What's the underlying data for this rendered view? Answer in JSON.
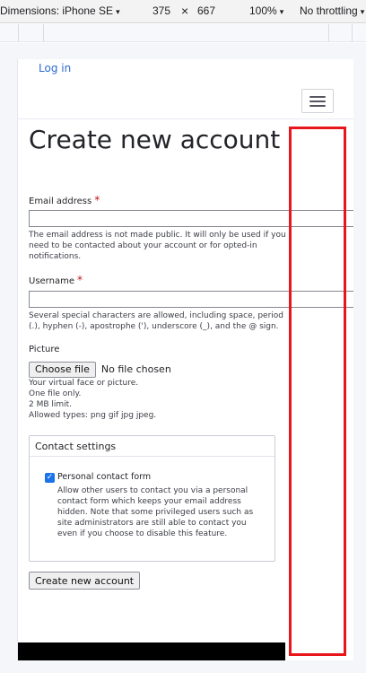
{
  "devtools": {
    "dimensions_label": "Dimensions: iPhone SE",
    "width": "375",
    "times": "×",
    "height": "667",
    "zoom": "100%",
    "throttle": "No throttling",
    "caret": "▾"
  },
  "header": {
    "login_link": "Log in",
    "menu_icon": "hamburger-menu-icon"
  },
  "page": {
    "title": "Create new account"
  },
  "form": {
    "email": {
      "label": "Email address",
      "required_marker": "*",
      "value": "",
      "help": "The email address is not made public. It will only be used if you need to be contacted about your account or for opted-in notifications."
    },
    "username": {
      "label": "Username",
      "required_marker": "*",
      "value": "",
      "help": "Several special characters are allowed, including space, period (.), hyphen (-), apostrophe ('), underscore (_), and the @ sign."
    },
    "picture": {
      "label": "Picture",
      "button_label": "Choose file",
      "status": "No file chosen",
      "help_lines": [
        "Your virtual face or picture.",
        "One file only.",
        "2 MB limit.",
        "Allowed types: png gif jpg jpeg."
      ]
    },
    "contact_settings": {
      "legend": "Contact settings",
      "checkbox_checked": true,
      "checkbox_mark": "✓",
      "checkbox_label": "Personal contact form",
      "description": "Allow other users to contact you via a personal contact form which keeps your email address hidden. Note that some privileged users such as site administrators are still able to contact you even if you choose to disable this feature."
    },
    "submit_label": "Create new account"
  },
  "colors": {
    "link": "#2b6bd1",
    "required": "#c01515",
    "checkbox": "#1a73e8",
    "annotation": "#e8161b"
  }
}
